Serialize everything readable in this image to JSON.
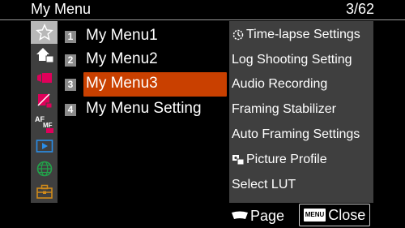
{
  "header": {
    "title": "My Menu",
    "page_indicator": "3/62"
  },
  "sidebar": {
    "tabs": [
      {
        "icon": "star-icon",
        "active": true
      },
      {
        "icon": "home-camera-icon",
        "active": false
      },
      {
        "icon": "movie-camera-icon",
        "active": false
      },
      {
        "icon": "exposure-icon",
        "active": false
      },
      {
        "icon": "af-mf-icon",
        "active": false
      },
      {
        "icon": "playback-icon",
        "active": false
      },
      {
        "icon": "network-globe-icon",
        "active": false
      },
      {
        "icon": "toolbox-icon",
        "active": false
      }
    ]
  },
  "menu": {
    "items": [
      {
        "number": "1",
        "label": "My Menu1"
      },
      {
        "number": "2",
        "label": "My Menu2"
      },
      {
        "number": "3",
        "label": "My Menu3",
        "selected": true
      },
      {
        "number": "4",
        "label": "My Menu Setting"
      }
    ]
  },
  "preview": {
    "items": [
      {
        "label": "Time-lapse Settings",
        "icon": "timelapse-icon"
      },
      {
        "label": "Log Shooting Setting"
      },
      {
        "label": "Audio Recording"
      },
      {
        "label": "Framing Stabilizer"
      },
      {
        "label": "Auto Framing Settings"
      },
      {
        "label": "Picture Profile",
        "icon": "picture-profile-icon"
      },
      {
        "label": "Select LUT"
      }
    ]
  },
  "footer": {
    "page_label": "Page",
    "menu_key": "MENU",
    "close_label": "Close"
  },
  "colors": {
    "selection": "#c94000",
    "panel": "#3f3f3f"
  }
}
